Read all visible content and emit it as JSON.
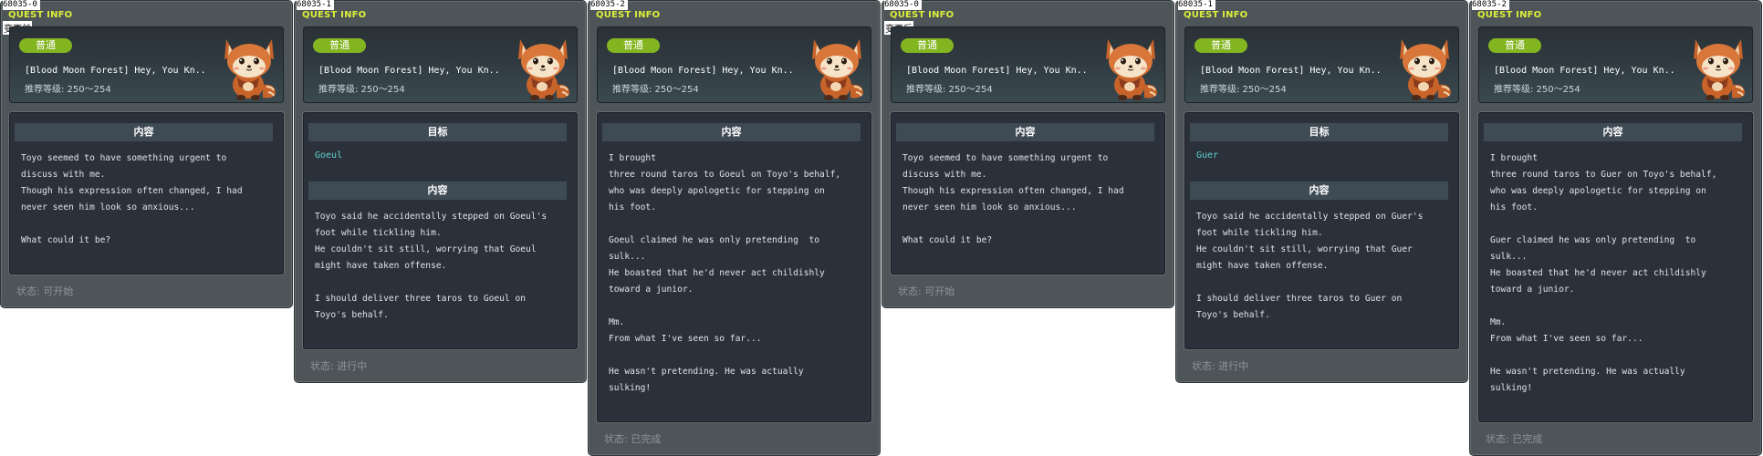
{
  "panels": [
    {
      "id": "68035-0",
      "titlebar": "QUEST INFO",
      "side_note": "变更前",
      "badge": "普通",
      "title": "[Blood Moon Forest] Hey, You Kn..",
      "level": "推荐等级: 250～254",
      "target_header": "",
      "target": "",
      "content_header": "内容",
      "content": "Toyo seemed to have something urgent to\ndiscuss with me.\nThough his expression often changed, I had\nnever seen him look so anxious...\n\nWhat could it be?",
      "status": "状态: 可开始"
    },
    {
      "id": "68035-1",
      "titlebar": "QUEST INFO",
      "side_note": "",
      "badge": "普通",
      "title": "[Blood Moon Forest] Hey, You Kn..",
      "level": "推荐等级: 250～254",
      "target_header": "目标",
      "target": "Goeul",
      "content_header": "内容",
      "content": "Toyo said he accidentally stepped on Goeul's\nfoot while tickling him.\nHe couldn't sit still, worrying that Goeul\nmight have taken offense.\n\nI should deliver three taros to Goeul on\nToyo's behalf.",
      "status": "状态: 进行中"
    },
    {
      "id": "68035-2",
      "titlebar": "QUEST INFO",
      "side_note": "",
      "badge": "普通",
      "title": "[Blood Moon Forest] Hey, You Kn..",
      "level": "推荐等级: 250～254",
      "target_header": "",
      "target": "",
      "content_header": "内容",
      "content": "I brought\nthree round taros to Goeul on Toyo's behalf,\nwho was deeply apologetic for stepping on\nhis foot.\n\nGoeul claimed he was only pretending  to\nsulk...\nHe boasted that he'd never act childishly\ntoward a junior.\n\nMm.\nFrom what I've seen so far...\n\nHe wasn't pretending. He was actually\nsulking!",
      "status": "状态: 已完成"
    },
    {
      "id": "68035-0",
      "titlebar": "QUEST INFO",
      "side_note": "变更后",
      "badge": "普通",
      "title": "[Blood Moon Forest] Hey, You Kn..",
      "level": "推荐等级: 250～254",
      "target_header": "",
      "target": "",
      "content_header": "内容",
      "content": "Toyo seemed to have something urgent to\ndiscuss with me.\nThough his expression often changed, I had\nnever seen him look so anxious...\n\nWhat could it be?",
      "status": "状态: 可开始"
    },
    {
      "id": "68035-1",
      "titlebar": "QUEST INFO",
      "side_note": "",
      "badge": "普通",
      "title": "[Blood Moon Forest] Hey, You Kn..",
      "level": "推荐等级: 250～254",
      "target_header": "目标",
      "target": "Guer",
      "content_header": "内容",
      "content": "Toyo said he accidentally stepped on Guer's\nfoot while tickling him.\nHe couldn't sit still, worrying that Guer\nmight have taken offense.\n\nI should deliver three taros to Guer on\nToyo's behalf.",
      "status": "状态: 进行中"
    },
    {
      "id": "68035-2",
      "titlebar": "QUEST INFO",
      "side_note": "",
      "badge": "普通",
      "title": "[Blood Moon Forest] Hey, You Kn..",
      "level": "推荐等级: 250～254",
      "target_header": "",
      "target": "",
      "content_header": "内容",
      "content": "I brought\nthree round taros to Guer on Toyo's behalf,\nwho was deeply apologetic for stepping on\nhis foot.\n\nGuer claimed he was only pretending  to\nsulk...\nHe boasted that he'd never act childishly\ntoward a junior.\n\nMm.\nFrom what I've seen so far...\n\nHe wasn't pretending. He was actually\nsulking!",
      "status": "状态: 已完成"
    }
  ],
  "colors": {
    "panel_bg": "#4e5558",
    "content_bg": "#2b313a",
    "section_bar": "#3f4b54",
    "badge": "#83b520",
    "titlebar": "#dcef3a",
    "target_name": "#5fd4cf",
    "status_text": "#8d9599"
  },
  "icons": {
    "mascot": "red-panda-mascot"
  }
}
